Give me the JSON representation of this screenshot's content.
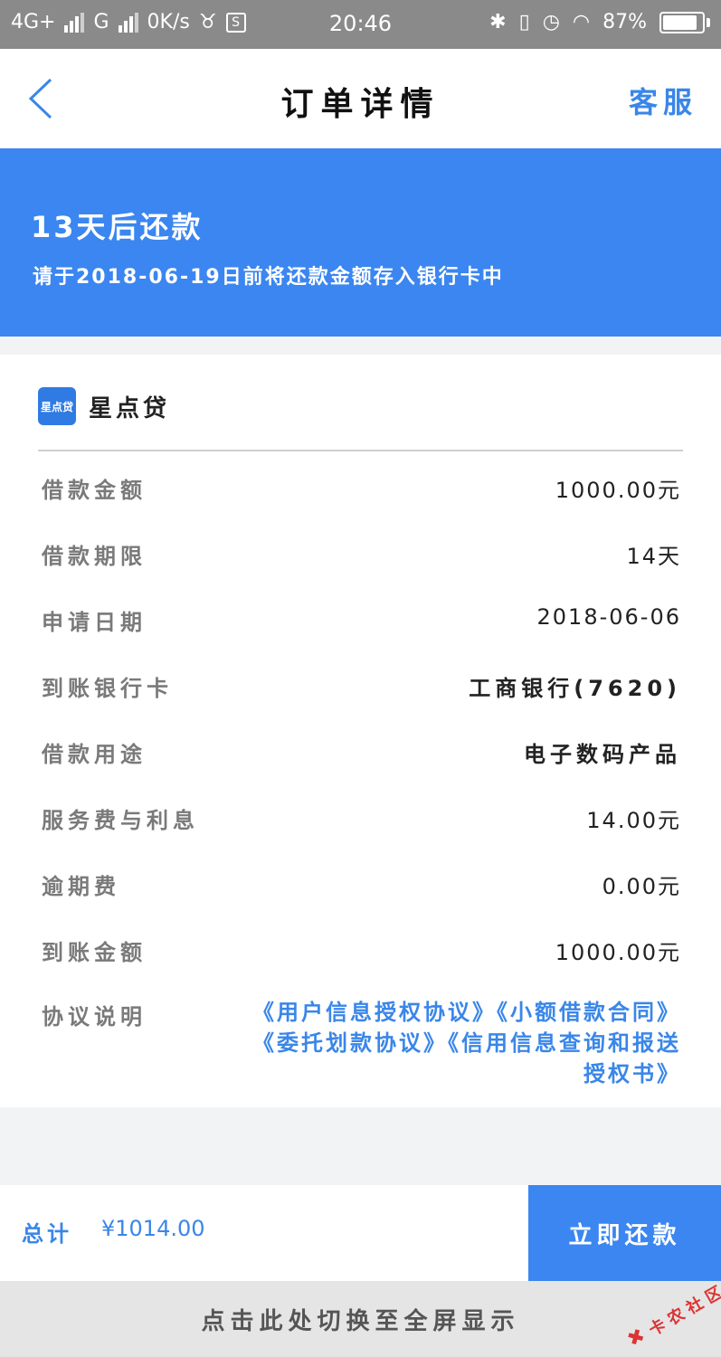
{
  "status_bar": {
    "network1": "4G+",
    "network2": "G",
    "speed": "0K/s",
    "time": "20:46",
    "battery": "87%",
    "battery_level": 0.87
  },
  "nav": {
    "title": "订单详情",
    "service": "客服"
  },
  "banner": {
    "days_text": "13天后还款",
    "hint": "请于2018-06-19日前将还款金额存入银行卡中"
  },
  "merchant": {
    "name": "星点贷",
    "logo_text": "星点贷"
  },
  "details": [
    {
      "label": "借款金额",
      "value": "1000.00元"
    },
    {
      "label": "借款期限",
      "value": "14天"
    },
    {
      "label": "申请日期",
      "value": "2018-06-06"
    },
    {
      "label": "到账银行卡",
      "value": "工商银行(7620)"
    },
    {
      "label": "借款用途",
      "value": "电子数码产品"
    },
    {
      "label": "服务费与利息",
      "value": "14.00元"
    },
    {
      "label": "逾期费",
      "value": "0.00元"
    },
    {
      "label": "到账金额",
      "value": "1000.00元"
    }
  ],
  "protocol": {
    "label": "协议说明",
    "links": [
      "《用户信息授权协议》",
      "《小额借款合同》",
      "《委托划款协议》",
      "《信用信息查询和报送授权书》"
    ]
  },
  "footer": {
    "total_label": "总计",
    "total_value": "¥1014.00",
    "pay_button": "立即还款",
    "fullscreen_hint": "点击此处切换至全屏显示",
    "watermark": "卡农社区"
  },
  "colors": {
    "accent": "#3b86f0",
    "link": "#3a86e8"
  }
}
